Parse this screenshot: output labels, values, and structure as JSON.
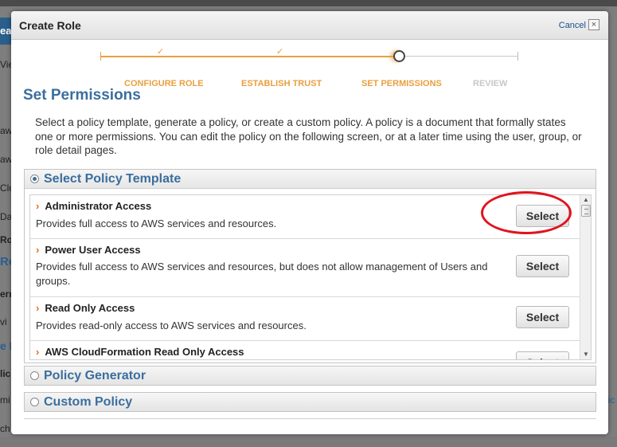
{
  "background": {
    "left_items": [
      "ea",
      "Vie",
      "aw",
      "aw",
      "Clo",
      "Da",
      "Ro",
      "Ro",
      "ern",
      "vi",
      "e F",
      "lici",
      "mi",
      "ch"
    ],
    "right_items": [
      "lic"
    ]
  },
  "modal": {
    "title": "Create Role",
    "cancel_label": "Cancel",
    "close_glyph": "×"
  },
  "wizard": {
    "steps": [
      {
        "label": "CONFIGURE ROLE",
        "state": "done"
      },
      {
        "label": "ESTABLISH TRUST",
        "state": "done"
      },
      {
        "label": "SET PERMISSIONS",
        "state": "current"
      },
      {
        "label": "REVIEW",
        "state": "todo"
      }
    ],
    "check_glyph": "✓",
    "accent_color": "#e8a040"
  },
  "page": {
    "title": "Set Permissions",
    "description": "Select a policy template, generate a policy, or create a custom policy. A policy is a document that formally states one or more permissions. You can edit the policy on the following screen, or at a later time using the user, group, or role detail pages."
  },
  "policy_options": {
    "template": {
      "label": "Select Policy Template",
      "selected": true
    },
    "generator": {
      "label": "Policy Generator",
      "selected": false
    },
    "custom": {
      "label": "Custom Policy",
      "selected": false
    }
  },
  "templates": [
    {
      "name": "Administrator Access",
      "description": "Provides full access to AWS services and resources.",
      "button": "Select"
    },
    {
      "name": "Power User Access",
      "description": "Provides full access to AWS services and resources, but does not allow management of Users and groups.",
      "button": "Select"
    },
    {
      "name": "Read Only Access",
      "description": "Provides read-only access to AWS services and resources.",
      "button": "Select"
    },
    {
      "name": "AWS CloudFormation Read Only Access",
      "description": "",
      "button": "Select"
    }
  ],
  "scrollbar": {
    "up_glyph": "▲",
    "down_glyph": "▼"
  },
  "chevron_glyph": "›",
  "colors": {
    "heading": "#3b6e9e",
    "accent": "#e8a040",
    "annotation": "#e0141e"
  }
}
